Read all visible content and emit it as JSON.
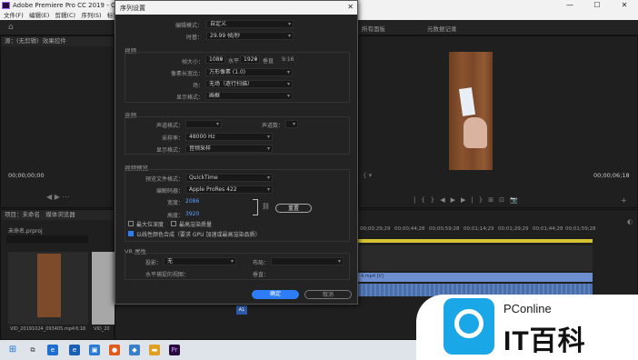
{
  "app": {
    "title": "Adobe Premiere Pro CC 2019 - C:\\用户\\A\\文",
    "menu": [
      "文件(F)",
      "编辑(E)",
      "剪辑(C)",
      "序列(S)",
      "标记(M)",
      "图"
    ],
    "window_controls": [
      "—",
      "☐",
      "✕"
    ]
  },
  "workspace": {
    "tabs": [
      "所有面板",
      "元数据记录"
    ]
  },
  "source_panel": {
    "header": "源：(无剪辑)",
    "header2": "效果控件",
    "timecode_left": "00;00;00;00"
  },
  "program_monitor": {
    "timecode_right": "00;00;06;18"
  },
  "project_panel": {
    "tabs": [
      "项目：未命名",
      "媒体浏览器"
    ],
    "file": "未命名.prproj",
    "clips": [
      {
        "name": "VID_20191024_093405.mp4",
        "duration": "6;18"
      },
      {
        "name": "VID_20"
      }
    ]
  },
  "dialog": {
    "title": "序列设置",
    "close": "✕",
    "top": {
      "edit_mode_label": "编辑模式：",
      "edit_mode_value": "自定义",
      "timebase_label": "时基：",
      "timebase_value": "29.99 帧/秒"
    },
    "video": {
      "section": "视频",
      "frame_size_label": "帧大小：",
      "frame_w": "1080",
      "horiz_label": "水平",
      "frame_h": "1920",
      "vert_label": "垂直",
      "ratio": "9:16",
      "pixel_aspect_label": "像素长宽比：",
      "pixel_aspect_value": "方形像素 (1.0)",
      "field_label": "场：",
      "field_value": "无场（逐行扫描）",
      "display_format_label": "显示格式：",
      "display_format_value": "画框"
    },
    "audio": {
      "section": "音频",
      "sample_format_label": "声道格式：",
      "channels_label": "声道数：",
      "sample_rate_label": "采样率：",
      "sample_rate_value": "48000 Hz",
      "display_format_label": "显示格式：",
      "display_format_value": "音频采样"
    },
    "preview": {
      "section": "视频预览",
      "file_format_label": "预览文件格式：",
      "file_format_value": "QuickTime",
      "codec_label": "编解码器：",
      "codec_value": "Apple ProRes 422",
      "width_label": "宽度：",
      "width_value": "2086",
      "height_label": "高度：",
      "height_value": "3920",
      "reset_label": "重置",
      "max_depth_label": "最大位深度",
      "max_quality_label": "最高渲染质量",
      "linear_label": "以线性颜色合成（要求 GPU 加速或最高渲染品质）"
    },
    "vr": {
      "section": "VR 属性",
      "projection_label": "投影：",
      "projection_value": "无",
      "layout_label": "布局：",
      "horizontal_label": "水平捕捉的视图：",
      "vertical_label": "垂直："
    },
    "ok_label": "确定",
    "cancel_label": "取消"
  },
  "timeline": {
    "ruler": [
      "00;00;29;29",
      "00;00;44;28",
      "00;00;59;28",
      "00;01;14;29",
      "00;01;29;29",
      "00;01;44;28",
      "00;01;59;28"
    ],
    "clip_label": "4.mp4 [V]",
    "track_btn": "A1"
  },
  "watermark": {
    "brand": "PConline",
    "text": "IT百科"
  },
  "colors": {
    "accent_blue": "#2d7df6",
    "premiere_purple": "#9b6bff",
    "clip_video": "#6e8fcf",
    "clip_audio": "#4a6ea8"
  }
}
